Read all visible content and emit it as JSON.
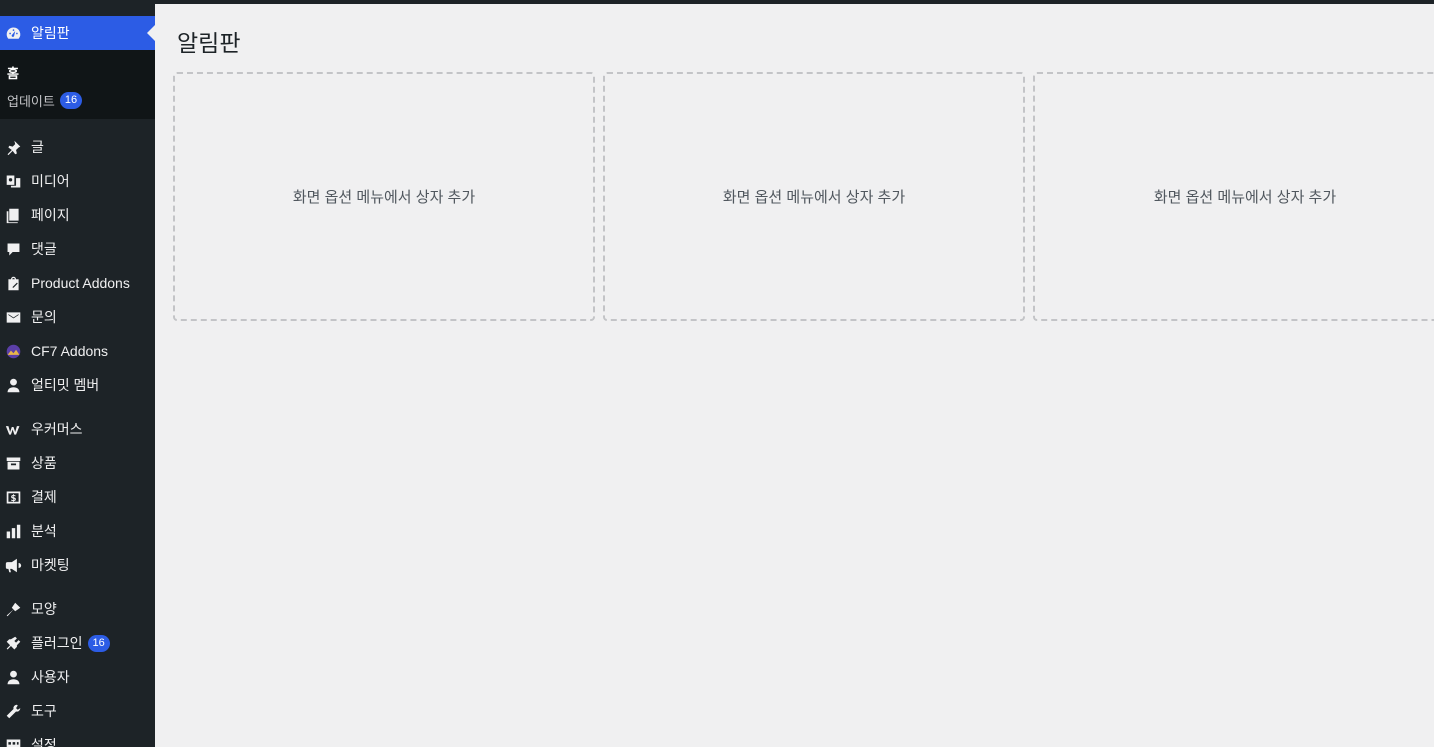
{
  "sidebar": {
    "current": {
      "label": "알림판",
      "icon": "dashboard-icon"
    },
    "submenu": [
      {
        "label": "홈"
      },
      {
        "label": "업데이트",
        "badge": "16"
      }
    ],
    "items": [
      {
        "label": "글",
        "icon": "pin-icon"
      },
      {
        "label": "미디어",
        "icon": "media-icon"
      },
      {
        "label": "페이지",
        "icon": "page-icon"
      },
      {
        "label": "댓글",
        "icon": "comment-icon"
      },
      {
        "label": "Product Addons",
        "icon": "product-addons-icon"
      },
      {
        "label": "문의",
        "icon": "mail-icon"
      },
      {
        "label": "CF7 Addons",
        "icon": "cf7-addons-icon"
      },
      {
        "label": "얼티밋 멤버",
        "icon": "user-icon"
      },
      {
        "label": "우커머스",
        "icon": "woocommerce-icon"
      },
      {
        "label": "상품",
        "icon": "archive-icon"
      },
      {
        "label": "결제",
        "icon": "payment-icon"
      },
      {
        "label": "분석",
        "icon": "chart-bar-icon"
      },
      {
        "label": "마켓팅",
        "icon": "megaphone-icon"
      },
      {
        "label": "모양",
        "icon": "appearance-icon"
      },
      {
        "label": "플러그인",
        "icon": "plugin-icon",
        "badge": "16"
      },
      {
        "label": "사용자",
        "icon": "user-icon"
      },
      {
        "label": "도구",
        "icon": "wrench-icon"
      },
      {
        "label": "설정",
        "icon": "settings-icon"
      }
    ]
  },
  "main": {
    "title": "알림판",
    "boxes": [
      {
        "text": "화면 옵션 메뉴에서 상자 추가"
      },
      {
        "text": "화면 옵션 메뉴에서 상자 추가"
      },
      {
        "text": "화면 옵션 메뉴에서 상자 추가"
      }
    ]
  },
  "colors": {
    "sidebar_bg": "#1d2327",
    "accent": "#2c5ce5",
    "content_bg": "#f0f0f1"
  }
}
